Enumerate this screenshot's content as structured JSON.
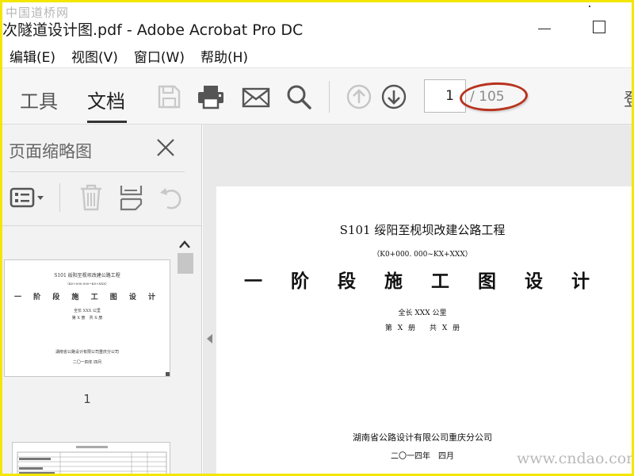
{
  "watermarks": {
    "top_left": "中国道桥网",
    "bottom_right": "www.cndao.com"
  },
  "window": {
    "title": "次隧道设计图.pdf - Adobe Acrobat Pro DC"
  },
  "menu": {
    "items": [
      {
        "label": "编辑(E)"
      },
      {
        "label": "视图(V)"
      },
      {
        "label": "窗口(W)"
      },
      {
        "label": "帮助(H)"
      }
    ]
  },
  "toolbar": {
    "tabs": [
      {
        "label": "工具"
      },
      {
        "label": "文档",
        "active": true
      }
    ],
    "icons": [
      "save-icon",
      "print-icon",
      "email-icon",
      "search-icon",
      "page-up-icon",
      "page-down-icon"
    ],
    "page_current": "1",
    "page_total": "/ 105",
    "cut_off_text": "登",
    "highlight_color": "#b8331f"
  },
  "left_pane": {
    "title": "页面缩略图",
    "thumbnail_page_label": "1",
    "thumbnail": {
      "title": "S101 绥阳至枧坝改建公路工程",
      "range": "（K0+000.000~K0+XXX）",
      "main": "一 阶 段 施 工 图 设 计",
      "length": "全长 XXX 公里",
      "volume": "第 X 册　共 X 册",
      "company": "湖南省公路设计有限公司重庆分公司",
      "date": "二〇一四年 四月"
    }
  },
  "document": {
    "title": "S101 绥阳至枧坝改建公路工程",
    "range": "（K0+000. 000~KX+XXX）",
    "main": "一 阶 段 施 工 图 设 计",
    "length": "全长 XXX 公里",
    "volume": "第 X 册　　共 X 册",
    "company": "湖南省公路设计有限公司重庆分公司",
    "date": "二〇一四年　四月"
  }
}
